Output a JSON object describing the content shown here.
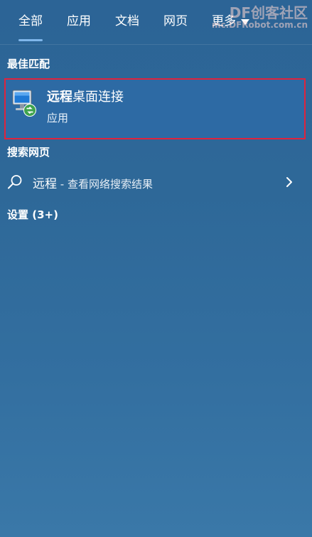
{
  "tabs": [
    {
      "label": "全部",
      "active": true
    },
    {
      "label": "应用",
      "active": false
    },
    {
      "label": "文档",
      "active": false
    },
    {
      "label": "网页",
      "active": false
    },
    {
      "label": "更多",
      "active": false
    }
  ],
  "watermark": {
    "line1": "DF创客社区",
    "line2": "mc.DFRobot.com.cn"
  },
  "best_match": {
    "section_title": "最佳匹配",
    "name_highlight": "远程",
    "name_rest": "桌面连接",
    "type": "应用",
    "icon": "remote-desktop-icon"
  },
  "web_search": {
    "section_title": "搜索网页",
    "query": "远程",
    "suffix": " - 查看网络搜索结果",
    "icon": "search-icon"
  },
  "settings": {
    "section_title": "设置 (3+)"
  },
  "colors": {
    "highlight_border": "#e0233c",
    "accent": "#7fb6ea",
    "background": "#2e6898"
  }
}
